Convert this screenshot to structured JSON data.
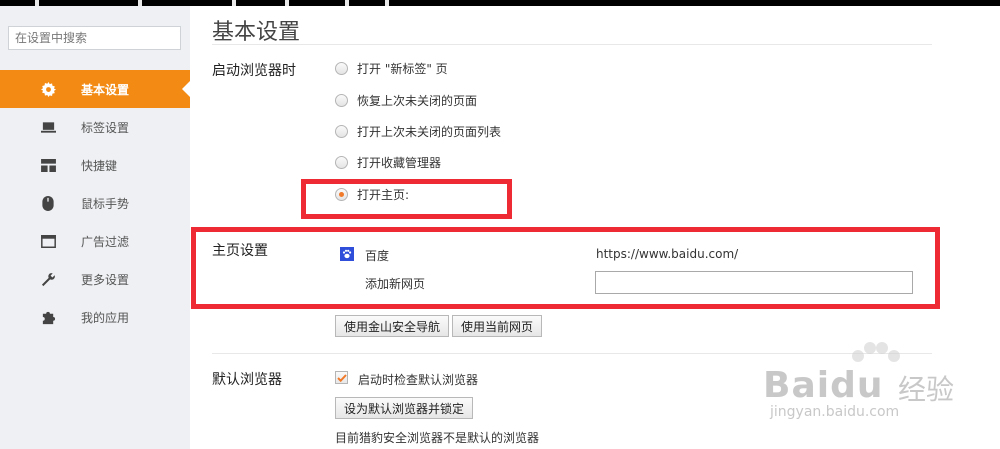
{
  "sidebar": {
    "search_placeholder": "在设置中搜索",
    "items": [
      {
        "label": "基本设置",
        "icon": "gear-icon",
        "active": true
      },
      {
        "label": "标签设置",
        "icon": "laptop-icon",
        "active": false
      },
      {
        "label": "快捷键",
        "icon": "layout-icon",
        "active": false
      },
      {
        "label": "鼠标手势",
        "icon": "mouse-icon",
        "active": false
      },
      {
        "label": "广告过滤",
        "icon": "window-icon",
        "active": false
      },
      {
        "label": "更多设置",
        "icon": "wrench-icon",
        "active": false
      },
      {
        "label": "我的应用",
        "icon": "puzzle-icon",
        "active": false
      }
    ]
  },
  "main": {
    "title": "基本设置",
    "startup": {
      "label": "启动浏览器时",
      "options": [
        "打开 \"新标签\" 页",
        "恢复上次未关闭的页面",
        "打开上次未关闭的页面列表",
        "打开收藏管理器",
        "打开主页:"
      ],
      "selected_index": 4
    },
    "homepage": {
      "label": "主页设置",
      "site_name": "百度",
      "site_url": "https://www.baidu.com/",
      "add_label": "添加新网页",
      "add_value": "",
      "btn_safe_nav": "使用金山安全导航",
      "btn_current": "使用当前网页"
    },
    "default_browser": {
      "label": "默认浏览器",
      "check_label": "启动时检查默认浏览器",
      "checked": true,
      "btn_set": "设为默认浏览器并锁定",
      "status": "目前猎豹安全浏览器不是默认的浏览器"
    }
  },
  "watermark": {
    "brand": "Bai",
    "brand2": "du",
    "cn": "经验",
    "url": "jingyan.baidu.com"
  },
  "colors": {
    "accent": "#f28a13",
    "highlight": "#ee2b34",
    "sidebar_bg": "#eef0f3"
  }
}
